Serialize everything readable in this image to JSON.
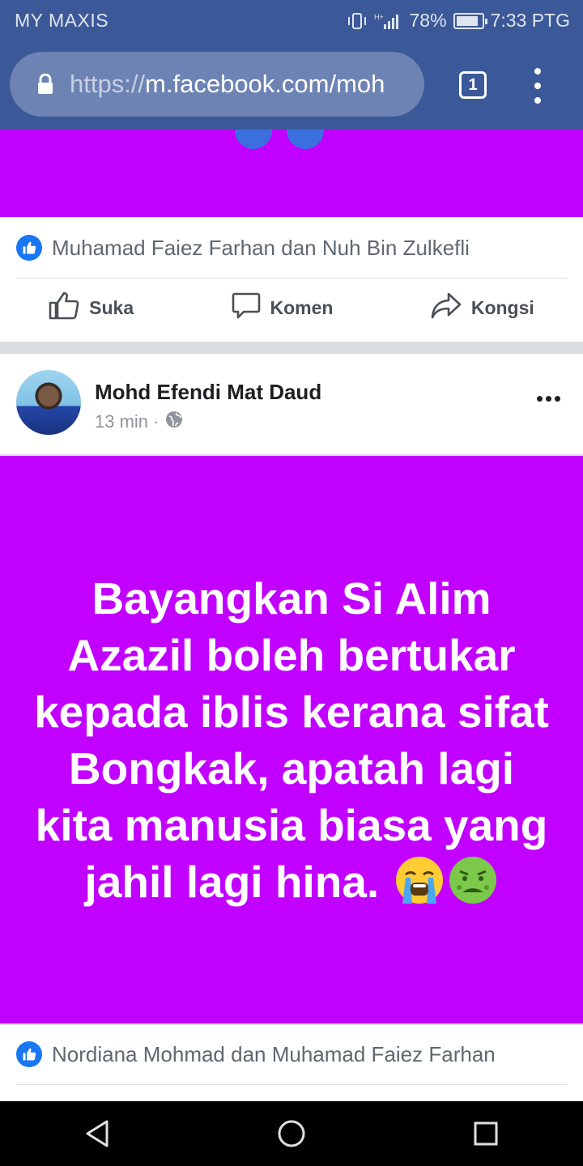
{
  "status_bar": {
    "carrier": "MY MAXIS",
    "network": "H+",
    "battery": "78%",
    "battery_level": 0.78,
    "time": "7:33 PTG"
  },
  "browser": {
    "url_scheme": "https://",
    "url_host": "m.facebook.com/moh",
    "tab_count": "1"
  },
  "post1": {
    "likes_text": "Muhamad Faiez Farhan dan Nuh Bin Zulkefli",
    "actions": {
      "like": "Suka",
      "comment": "Komen",
      "share": "Kongsi"
    }
  },
  "post2": {
    "author": "Mohd Efendi Mat Daud",
    "time": "13 min ·",
    "text": "Bayangkan Si Alim Azazil boleh bertukar kepada iblis kerana sifat Bongkak, apatah lagi kita manusia biasa yang jahil lagi hina.",
    "emojis": [
      "loudly-crying-face-icon",
      "nauseated-face-icon"
    ],
    "likes_text": "Nordiana Mohmad dan Muhamad Faiez Farhan"
  },
  "colors": {
    "facebook_blue": "#3b5998",
    "post_background": "#c100ff",
    "like_blue": "#1877f2"
  }
}
